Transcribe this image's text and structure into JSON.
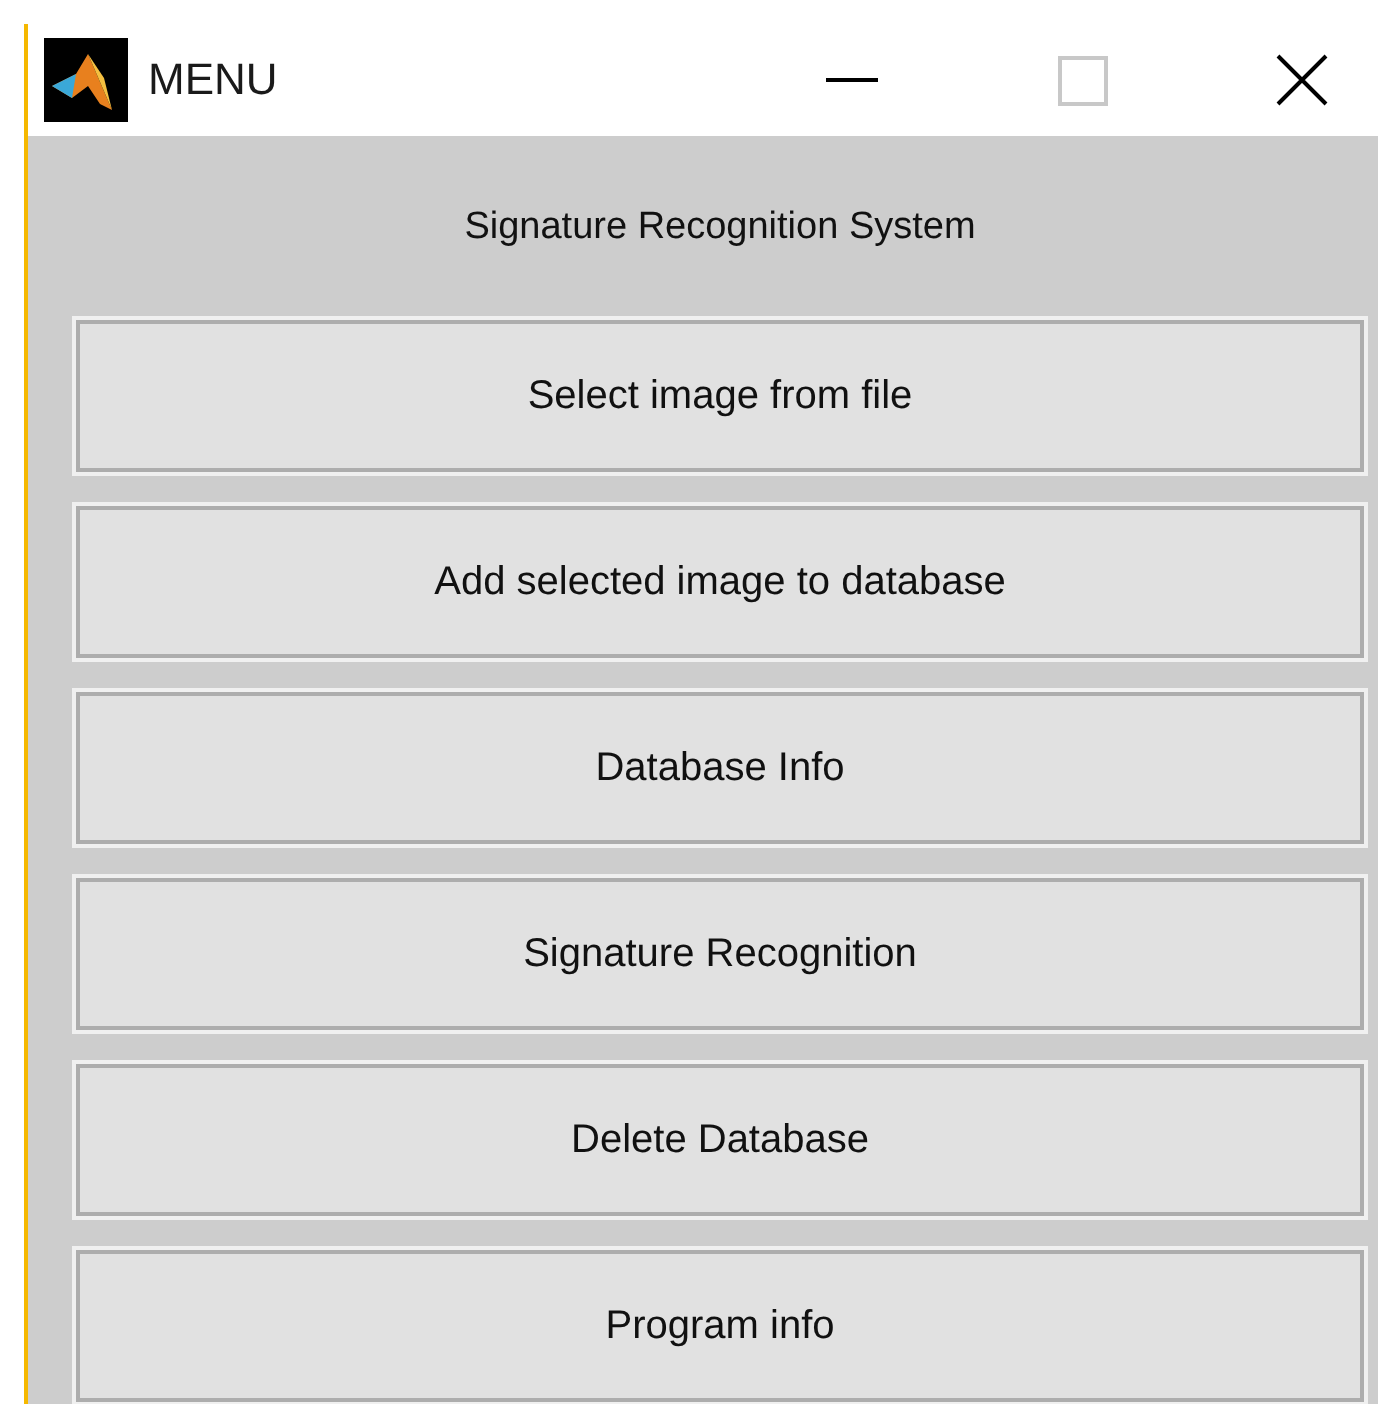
{
  "window": {
    "title": "MENU"
  },
  "header": "Signature Recognition System",
  "buttons": [
    "Select image from file",
    "Add selected image to database",
    "Database Info",
    "Signature Recognition",
    "Delete Database",
    "Program info"
  ]
}
